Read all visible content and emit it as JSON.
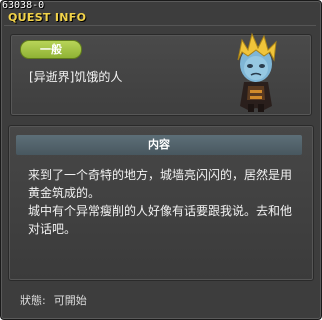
{
  "window": {
    "quest_id": "63038-0",
    "title": "QUEST INFO"
  },
  "quest": {
    "category": "一般",
    "name": "[异逝界]饥饿的人",
    "npc_icon": "blonde-character-sprite"
  },
  "content": {
    "header": "内容",
    "paragraphs": [
      "来到了一个奇特的地方，城墙亮闪闪的，居然是用黄金筑成的。",
      "城中有个异常瘦削的人好像有话要跟我说。去和他对话吧。"
    ]
  },
  "status": {
    "label": "狀態:",
    "value": "可開始"
  },
  "colors": {
    "window_bg": "#3d3d3d",
    "title": "#f2d34a",
    "badge": "#a3c447",
    "content_header": "#55666f"
  }
}
